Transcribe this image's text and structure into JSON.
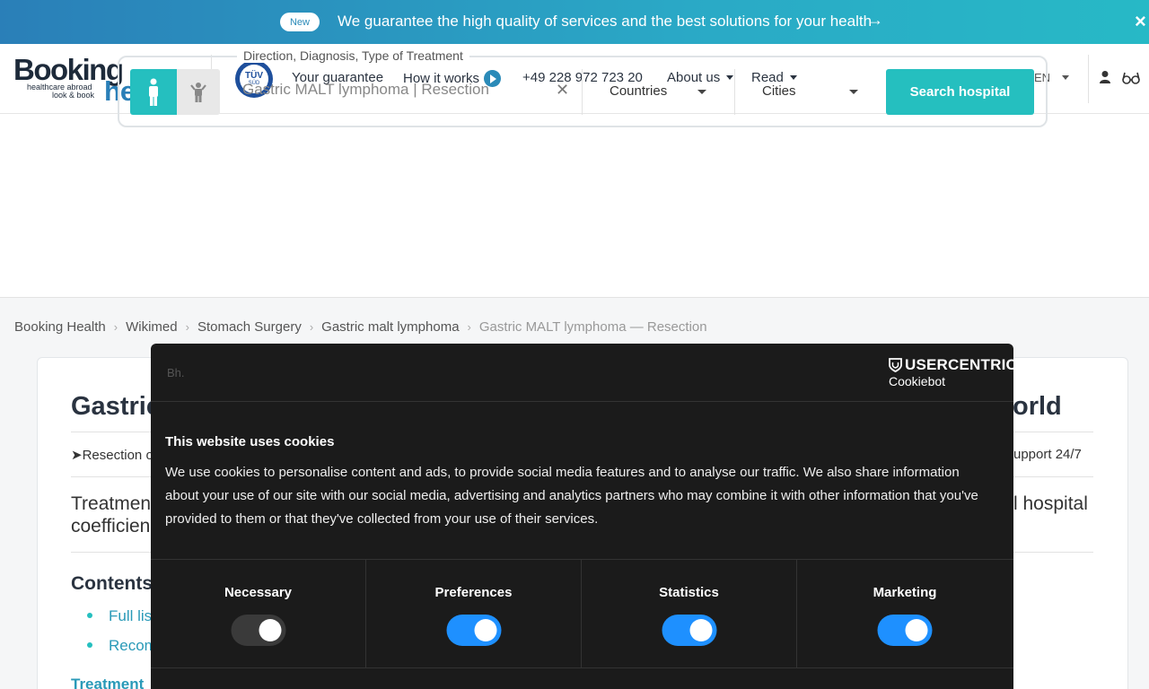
{
  "banner": {
    "badge": "New",
    "text": "We guarantee the high quality of services and the best solutions for your health",
    "arrow": "→",
    "close": "×"
  },
  "header": {
    "logo": {
      "word1": "Booking",
      "tagline1": "healthcare abroad",
      "tagline2": "look & book",
      "word2": "health"
    },
    "tuv": {
      "label": "TÜV",
      "sub": "SÜD"
    },
    "nav": {
      "guarantee": "Your guarantee",
      "how_it_works": "How it works",
      "phone": "+49 228 972 723 20",
      "about": "About us",
      "read": "Read"
    },
    "lang": "EN"
  },
  "search": {
    "legend": "Direction, Diagnosis, Type of Treatment",
    "query": "Gastric MALT lymphoma | Resection",
    "countries": "Countries",
    "cities": "Cities",
    "button": "Search hospital"
  },
  "breadcrumb": [
    "Booking Health",
    "Wikimed",
    "Stomach Surgery",
    "Gastric malt lymphoma",
    "Gastric MALT lymphoma — Resection"
  ],
  "content": {
    "title_left": "Gastric",
    "title_right": "orld",
    "line1_left": "➤Resection o",
    "line1_right": "upport 24/7",
    "treat_left1": "Treatmen",
    "treat_left2": "coefficien",
    "treat_right": "l hospital",
    "contents_heading": "Contents",
    "link1": "Full lis",
    "link2": "Recom",
    "link3": "Treatment"
  },
  "cookie": {
    "logo_text": "Bh.",
    "brand": "USERCENTRICS",
    "brand_sub": "Cookiebot",
    "title": "This website uses cookies",
    "body": "We use cookies to personalise content and ads, to provide social media features and to analyse our traffic. We also share information about your use of our site with our social media, advertising and analytics partners who may combine it with other information that you've provided to them or that they've collected from your use of their services.",
    "options": [
      {
        "label": "Necessary",
        "on": false
      },
      {
        "label": "Preferences",
        "on": true
      },
      {
        "label": "Statistics",
        "on": true
      },
      {
        "label": "Marketing",
        "on": true
      }
    ]
  },
  "colors": {
    "accent": "#25bfbf",
    "brand_blue": "#2a7fb8",
    "toggle_on": "#1e90ff"
  }
}
